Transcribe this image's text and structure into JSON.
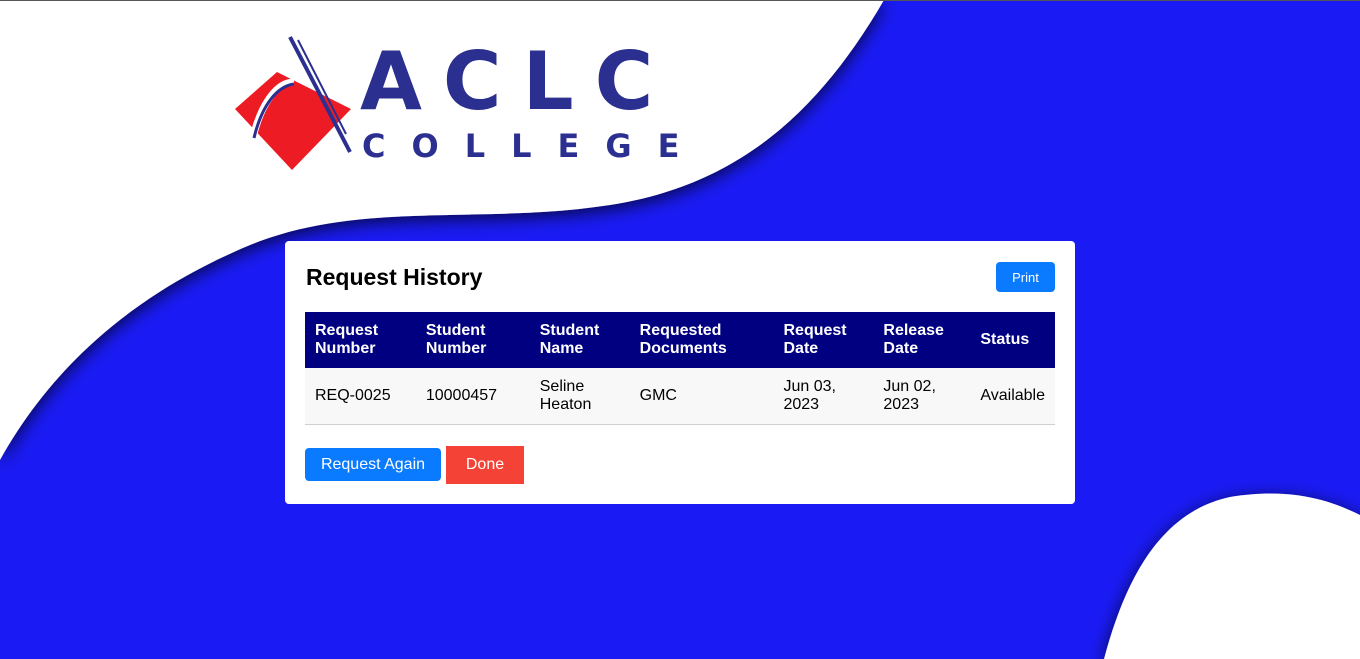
{
  "brand": {
    "logo_text_primary": "ACLC",
    "logo_text_secondary": "COLLEGE",
    "primary_color": "#2b2f8f",
    "accent_color": "#ed1c24",
    "background_color": "#1a1bf4"
  },
  "card": {
    "title": "Request History",
    "print_label": "Print"
  },
  "table": {
    "headers": {
      "request_number": "Request Number",
      "student_number": "Student Number",
      "student_name": "Student Name",
      "requested_documents": "Requested Documents",
      "request_date": "Request Date",
      "release_date": "Release Date",
      "status": "Status"
    },
    "rows": [
      {
        "request_number": "REQ-0025",
        "student_number": "10000457",
        "student_name": "Seline Heaton",
        "requested_documents": "GMC",
        "request_date": "Jun 03, 2023",
        "release_date": "Jun 02, 2023",
        "status": "Available"
      }
    ],
    "header_color": "#000080"
  },
  "actions": {
    "request_again_label": "Request Again",
    "done_label": "Done",
    "request_again_color": "#0a7bff",
    "done_color": "#f44336"
  }
}
